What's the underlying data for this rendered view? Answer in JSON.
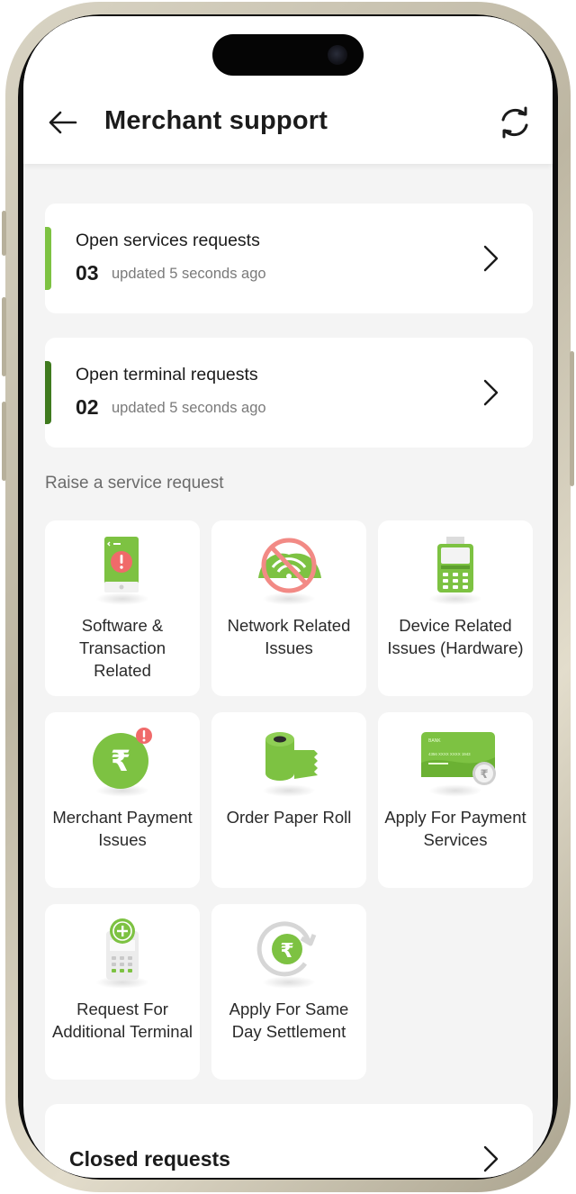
{
  "header": {
    "title": "Merchant support",
    "back_icon": "arrow-left-icon",
    "refresh_icon": "refresh-icon"
  },
  "requests": [
    {
      "title": "Open services requests",
      "count": "03",
      "updated": "updated 5 seconds ago",
      "accent": "#7dc242"
    },
    {
      "title": "Open terminal requests",
      "count": "02",
      "updated": "updated 5 seconds ago",
      "accent": "#3f7a1e"
    }
  ],
  "section_label": "Raise a service request",
  "tiles": [
    {
      "label": "Software & Transaction Related",
      "icon": "phone-alert-icon"
    },
    {
      "label": "Network Related Issues",
      "icon": "no-wifi-icon"
    },
    {
      "label": "Device Related Issues (Hardware)",
      "icon": "pos-terminal-icon"
    },
    {
      "label": "Merchant Payment Issues",
      "icon": "rupee-alert-icon"
    },
    {
      "label": "Order Paper Roll",
      "icon": "paper-roll-icon"
    },
    {
      "label": "Apply For Payment Services",
      "icon": "bank-card-icon"
    },
    {
      "label": "Request For Additional Terminal",
      "icon": "add-terminal-icon"
    },
    {
      "label": "Apply For Same Day Settlement",
      "icon": "rupee-cycle-icon"
    }
  ],
  "card_text": {
    "bank": "BANK",
    "numbers": "4356 XXXX XXXX 1943"
  },
  "closed": {
    "title": "Closed requests"
  },
  "colors": {
    "green": "#7dc242",
    "dark_green": "#3f7a1e",
    "alert_red": "#f06a6a",
    "background": "#f4f4f4"
  }
}
